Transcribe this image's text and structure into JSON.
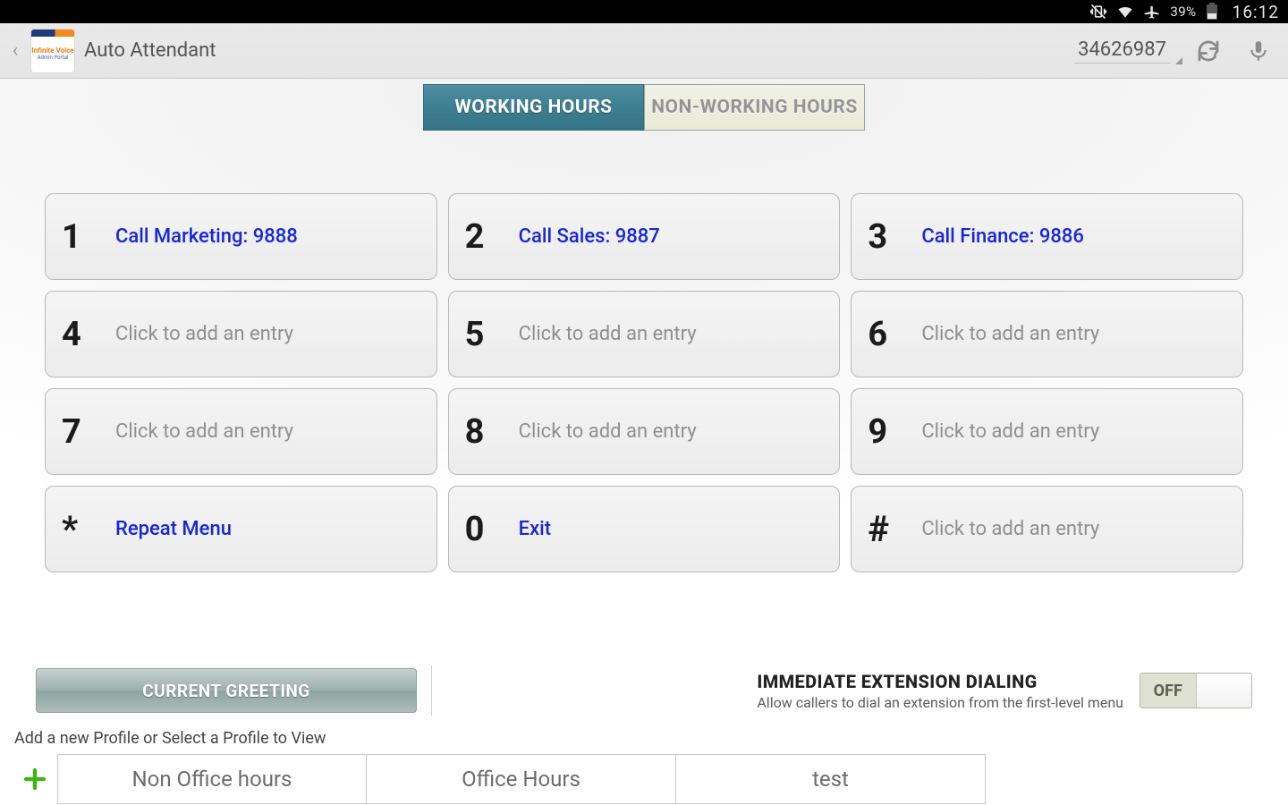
{
  "status": {
    "battery_pct": "39%",
    "clock": "16:12"
  },
  "header": {
    "title": "Auto Attendant",
    "account_number": "34626987"
  },
  "tabs": {
    "working": "WORKING HOURS",
    "nonworking": "NON-WORKING HOURS"
  },
  "keys": [
    {
      "digit": "1",
      "label": "Call Marketing: 9888",
      "assigned": true
    },
    {
      "digit": "2",
      "label": "Call Sales: 9887",
      "assigned": true
    },
    {
      "digit": "3",
      "label": "Call Finance: 9886",
      "assigned": true
    },
    {
      "digit": "4",
      "label": "Click to add an entry",
      "assigned": false
    },
    {
      "digit": "5",
      "label": "Click to add an entry",
      "assigned": false
    },
    {
      "digit": "6",
      "label": "Click to add an entry",
      "assigned": false
    },
    {
      "digit": "7",
      "label": "Click to add an entry",
      "assigned": false
    },
    {
      "digit": "8",
      "label": "Click to add an entry",
      "assigned": false
    },
    {
      "digit": "9",
      "label": "Click to add an entry",
      "assigned": false
    },
    {
      "digit": "*",
      "label": "Repeat Menu",
      "assigned": true
    },
    {
      "digit": "0",
      "label": "Exit",
      "assigned": true
    },
    {
      "digit": "#",
      "label": "Click to add an entry",
      "assigned": false
    }
  ],
  "greeting_button": "CURRENT GREETING",
  "ext": {
    "heading": "IMMEDIATE EXTENSION DIALING",
    "sub": "Allow callers to dial an extension from the first-level menu",
    "toggle_off": "OFF",
    "toggle_on": ""
  },
  "profiles": {
    "hint": "Add a new Profile or Select a Profile to View",
    "items": [
      "Non Office hours",
      "Office Hours",
      "test"
    ]
  }
}
